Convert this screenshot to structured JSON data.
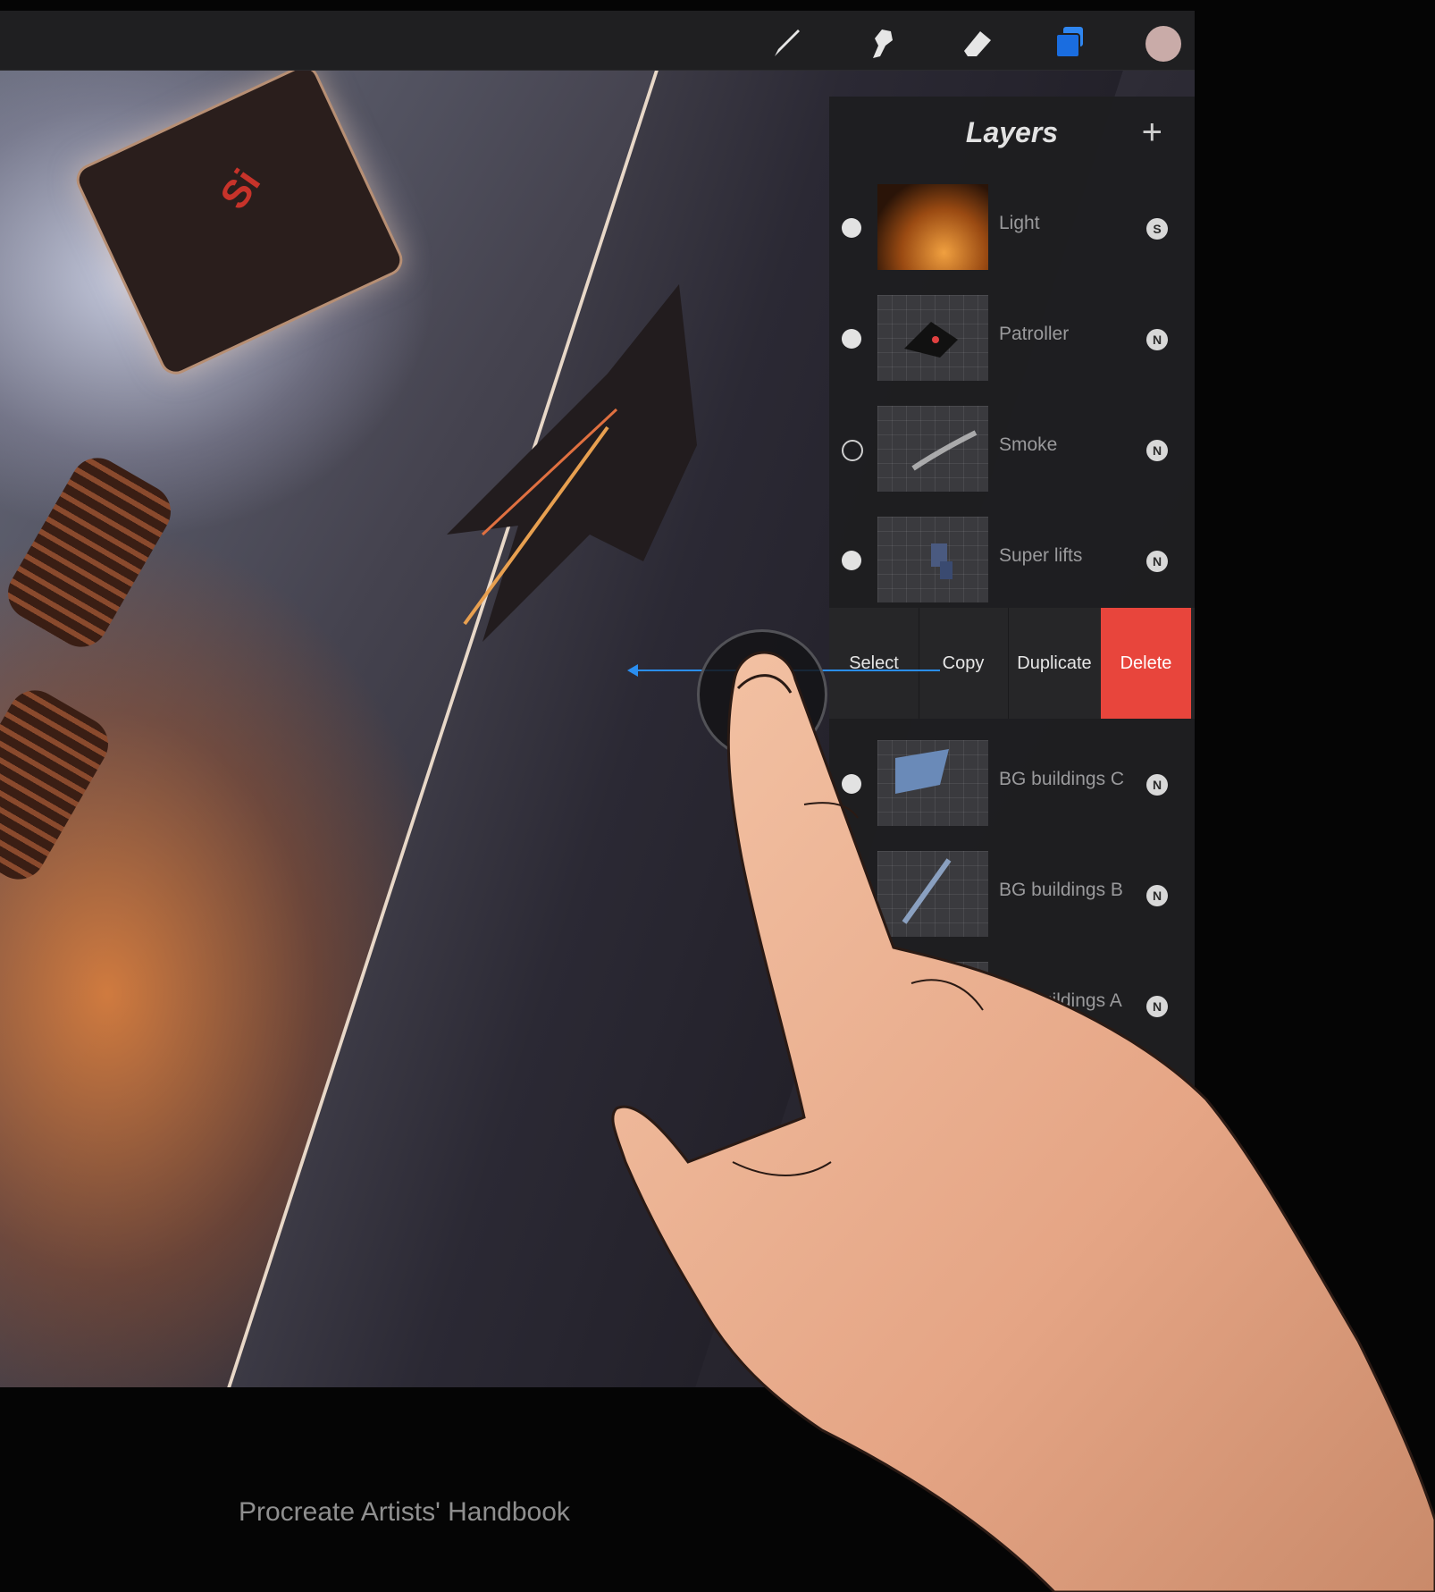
{
  "toolbar": {
    "tools": [
      "brush-icon",
      "smudge-icon",
      "eraser-icon",
      "layers-icon"
    ],
    "active_tool": "layers-icon",
    "active_color": "#1a6de0",
    "current_color": "#c9aba8"
  },
  "canvas": {
    "chip_label": "Si"
  },
  "layers_panel": {
    "title": "Layers",
    "add_label": "+",
    "layers": [
      {
        "name": "Light",
        "visible": true,
        "mode": "S"
      },
      {
        "name": "Patroller",
        "visible": true,
        "mode": "N"
      },
      {
        "name": "Smoke",
        "visible": false,
        "mode": "N"
      },
      {
        "name": "Super lifts",
        "visible": true,
        "mode": "N"
      },
      {
        "name": "BG buildings C",
        "visible": true,
        "mode": "N"
      },
      {
        "name": "BG buildings B",
        "visible": true,
        "mode": "N"
      },
      {
        "name": "BG buildings A",
        "visible": true,
        "mode": "N"
      }
    ],
    "actions": [
      "Select",
      "Copy",
      "Duplicate",
      "Delete"
    ],
    "delete_color": "#e8453c"
  },
  "gesture": {
    "type": "swipe-left",
    "arrow_color": "#2a8ef0"
  },
  "caption": "Procreate Artists' Handbook"
}
